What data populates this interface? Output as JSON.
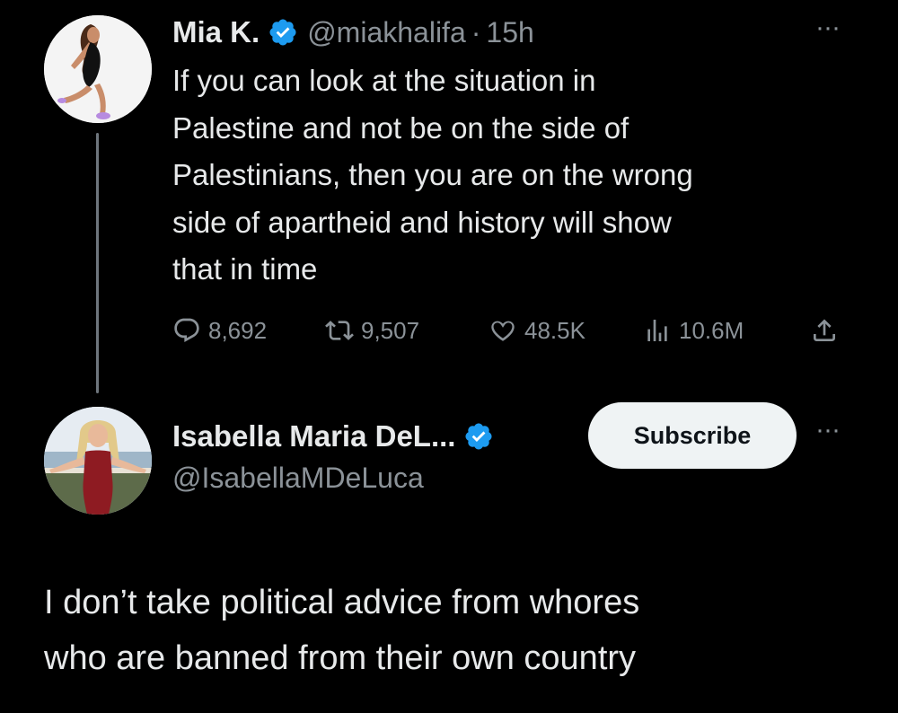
{
  "tweet1": {
    "display_name": "Mia K.",
    "handle": "@miakhalifa",
    "separator": "·",
    "time": "15h",
    "more_icon_label": "···",
    "text_lines": [
      "If you can look at the situation in",
      "Palestine and not be on the side of",
      "Palestinians, then you are on the wrong",
      "side of apartheid and history will show",
      "that in time"
    ],
    "stats": {
      "replies": "8,692",
      "reposts": "9,507",
      "likes": "48.5K",
      "views": "10.6M"
    },
    "icons": [
      "verified-badge-icon",
      "reply-icon",
      "retweet-icon",
      "heart-icon",
      "views-icon",
      "share-icon",
      "more-icon"
    ]
  },
  "tweet2": {
    "display_name": "Isabella Maria DeL...",
    "handle": "@IsabellaMDeLuca",
    "subscribe_label": "Subscribe",
    "more_icon_label": "···",
    "text_lines": [
      "I don’t take political advice from whores",
      "who are banned from their own country"
    ]
  },
  "colors": {
    "background": "#000000",
    "primary_text": "#e7e9ea",
    "secondary_text": "#8b9298",
    "verified_blue": "#1d9bf0",
    "subscribe_bg": "#eff3f4"
  }
}
